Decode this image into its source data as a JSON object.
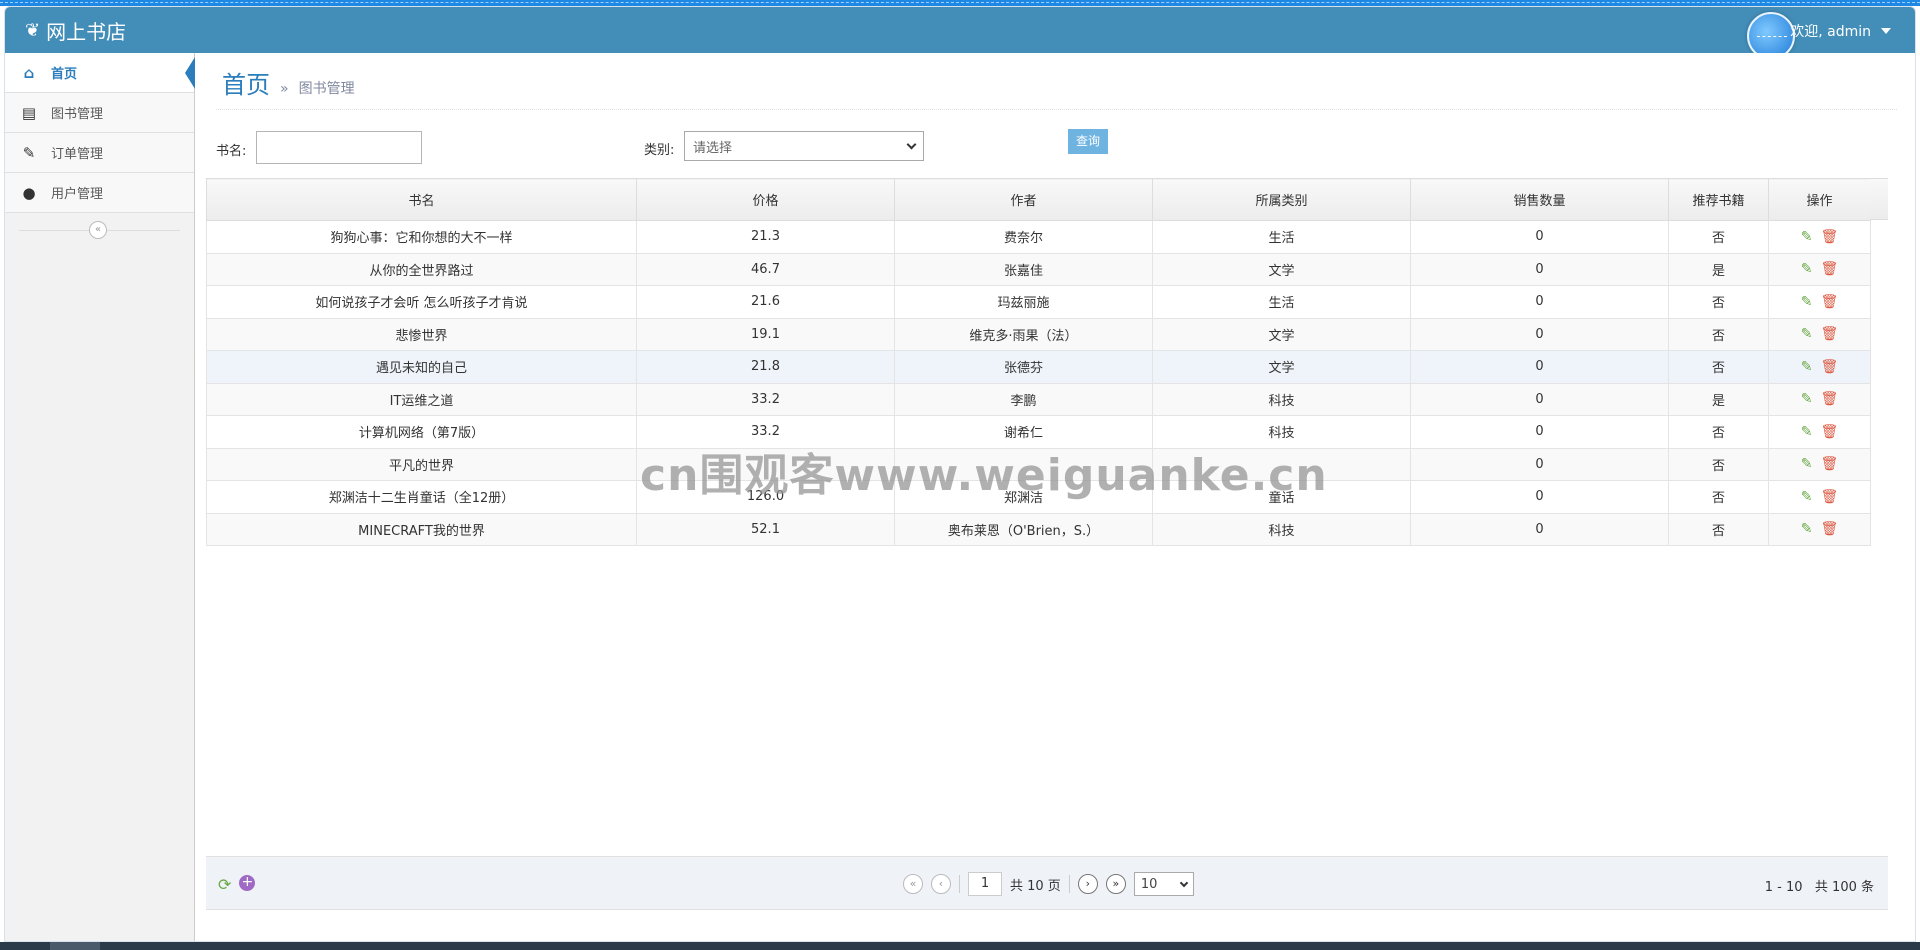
{
  "app": {
    "brand": "网上书店",
    "welcome": "欢迎, admin"
  },
  "sidebar": {
    "items": [
      {
        "label": "首页",
        "icon": "home-icon",
        "active": true
      },
      {
        "label": "图书管理",
        "icon": "book-icon",
        "active": false
      },
      {
        "label": "订单管理",
        "icon": "edit-icon",
        "active": false
      },
      {
        "label": "用户管理",
        "icon": "user-icon",
        "active": false
      }
    ]
  },
  "breadcrumb": {
    "home": "首页",
    "separator": "»",
    "current": "图书管理"
  },
  "search": {
    "name_label": "书名:",
    "name_value": "",
    "category_label": "类别:",
    "category_selected": "请选择",
    "query_button": "查询"
  },
  "table": {
    "columns": [
      "书名",
      "价格",
      "作者",
      "所属类别",
      "销售数量",
      "推荐书籍",
      "操作"
    ],
    "rows": [
      [
        "狗狗心事：它和你想的大不一样",
        "21.3",
        "费奈尔",
        "生活",
        "0",
        "否"
      ],
      [
        "从你的全世界路过",
        "46.7",
        "张嘉佳",
        "文学",
        "0",
        "是"
      ],
      [
        "如何说孩子才会听 怎么听孩子才肯说",
        "21.6",
        "玛兹丽施",
        "生活",
        "0",
        "否"
      ],
      [
        "悲惨世界",
        "19.1",
        "维克多·雨果（法）",
        "文学",
        "0",
        "否"
      ],
      [
        "遇见未知的自己",
        "21.8",
        "张德芬",
        "文学",
        "0",
        "否"
      ],
      [
        "IT运维之道",
        "33.2",
        "李鹏",
        "科技",
        "0",
        "是"
      ],
      [
        "计算机网络（第7版）",
        "33.2",
        "谢希仁",
        "科技",
        "0",
        "否"
      ],
      [
        "平凡的世界",
        "",
        "",
        "",
        "0",
        "否"
      ],
      [
        "郑渊洁十二生肖童话（全12册）",
        "126.0",
        "郑渊洁",
        "童话",
        "0",
        "否"
      ],
      [
        "MINECRAFT我的世界",
        "52.1",
        "奥布莱恩（O'Brien，S.）",
        "科技",
        "0",
        "否"
      ]
    ]
  },
  "pager": {
    "current_page": "1",
    "total_pages_text": "共 10 页",
    "page_size": "10",
    "range_text": "1 - 10",
    "total_text": "共 100 条"
  },
  "watermark": "cn围观客www.weiguanke.cn",
  "colors": {
    "navbar": "#438eb9",
    "accent": "#2b7dbc",
    "edit": "#69aa46",
    "delete": "#dd5a43"
  }
}
